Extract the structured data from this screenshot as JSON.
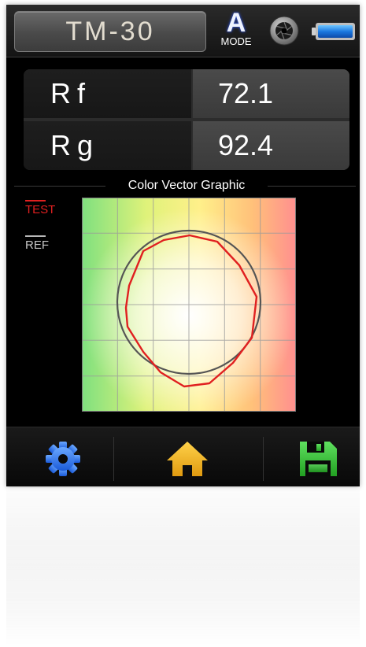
{
  "header": {
    "title": "TM-30",
    "mode_letter": "A",
    "mode_label": "MODE",
    "icons": [
      "shutter-icon",
      "battery-icon"
    ]
  },
  "readings": [
    {
      "label": "Rf",
      "value": "72.1"
    },
    {
      "label": "Rg",
      "value": "92.4"
    }
  ],
  "graph": {
    "title": "Color Vector Graphic",
    "legend_test": "TEST",
    "legend_ref": "REF",
    "test_color": "#e02020",
    "ref_color": "#555555"
  },
  "toolbar": {
    "buttons": [
      "gear-icon",
      "home-icon",
      "save-icon"
    ],
    "colors": {
      "gear": "#2a73e8",
      "home": "#f2b61a",
      "save": "#3cc23c"
    }
  }
}
